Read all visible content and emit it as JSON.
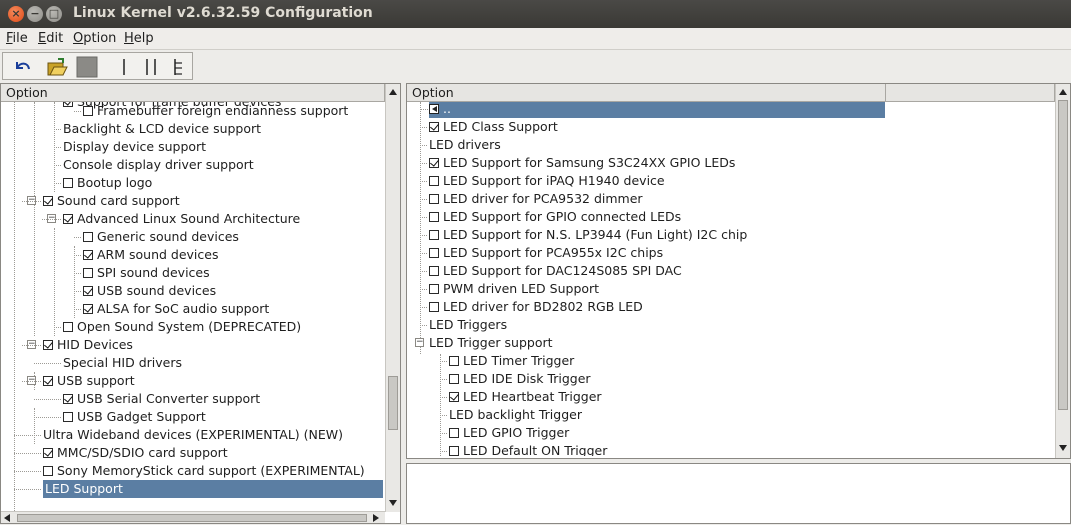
{
  "window": {
    "title": "Linux Kernel v2.6.32.59 Configuration",
    "close_glyph": "×",
    "min_glyph": "−",
    "max_glyph": "□"
  },
  "menubar": {
    "items": [
      {
        "label": "File",
        "underline": "F",
        "rest": "ile"
      },
      {
        "label": "Edit",
        "underline": "E",
        "rest": "dit"
      },
      {
        "label": "Option",
        "underline": "O",
        "rest": "ption"
      },
      {
        "label": "Help",
        "underline": "H",
        "rest": "elp"
      }
    ]
  },
  "toolbar": {
    "buttons": [
      "back-icon",
      "load-icon",
      "save-icon",
      "single-view-icon",
      "split-view-icon",
      "full-view-icon"
    ]
  },
  "left_pane": {
    "header": "Option",
    "partial_top": "Support for frame buffer devices",
    "rows": [
      {
        "label": "Framebuffer foreign endianness support",
        "check": "off"
      },
      {
        "label": "Backlight & LCD device support",
        "check": "none"
      },
      {
        "label": "Display device support",
        "check": "none"
      },
      {
        "label": "Console display driver support",
        "check": "none"
      },
      {
        "label": "Bootup logo",
        "check": "off"
      },
      {
        "label": "Sound card support",
        "check": "on"
      },
      {
        "label": "Advanced Linux Sound Architecture",
        "check": "on"
      },
      {
        "label": "Generic sound devices",
        "check": "off"
      },
      {
        "label": "ARM sound devices",
        "check": "on"
      },
      {
        "label": "SPI sound devices",
        "check": "off"
      },
      {
        "label": "USB sound devices",
        "check": "on"
      },
      {
        "label": "ALSA for SoC audio support",
        "check": "on"
      },
      {
        "label": "Open Sound System (DEPRECATED)",
        "check": "off"
      },
      {
        "label": "HID Devices",
        "check": "on"
      },
      {
        "label": "Special HID drivers",
        "check": "none"
      },
      {
        "label": "USB support",
        "check": "on"
      },
      {
        "label": "USB Serial Converter support",
        "check": "on"
      },
      {
        "label": "USB Gadget Support",
        "check": "off"
      },
      {
        "label": "Ultra Wideband devices (EXPERIMENTAL) (NEW)",
        "check": "none"
      },
      {
        "label": "MMC/SD/SDIO card support",
        "check": "on"
      },
      {
        "label": "Sony MemoryStick card support (EXPERIMENTAL)",
        "check": "off"
      },
      {
        "label": "LED Support",
        "check": "none",
        "selected": true
      }
    ]
  },
  "right_pane": {
    "header": "Option",
    "first_row": "..",
    "rows": [
      {
        "label": "LED Class Support",
        "check": "on"
      },
      {
        "label": "LED drivers",
        "check": "none"
      },
      {
        "label": "LED Support for Samsung S3C24XX GPIO LEDs",
        "check": "on"
      },
      {
        "label": "LED Support for iPAQ H1940 device",
        "check": "off"
      },
      {
        "label": "LED driver for PCA9532 dimmer",
        "check": "off"
      },
      {
        "label": "LED Support for GPIO connected LEDs",
        "check": "off"
      },
      {
        "label": "LED Support for N.S. LP3944 (Fun Light) I2C chip",
        "check": "off"
      },
      {
        "label": "LED Support for PCA955x I2C chips",
        "check": "off"
      },
      {
        "label": "LED Support for DAC124S085 SPI DAC",
        "check": "off"
      },
      {
        "label": "PWM driven LED Support",
        "check": "off"
      },
      {
        "label": "LED driver for BD2802 RGB LED",
        "check": "off"
      },
      {
        "label": "LED Triggers",
        "check": "none"
      },
      {
        "label": "LED Trigger support",
        "check": "none"
      },
      {
        "label": "LED Timer Trigger",
        "check": "off"
      },
      {
        "label": "LED IDE Disk Trigger",
        "check": "off"
      },
      {
        "label": "LED Heartbeat Trigger",
        "check": "on"
      },
      {
        "label": "LED backlight Trigger",
        "check": "none"
      },
      {
        "label": "LED GPIO Trigger",
        "check": "off"
      },
      {
        "label": "LED Default ON Trigger",
        "check": "off"
      }
    ]
  }
}
